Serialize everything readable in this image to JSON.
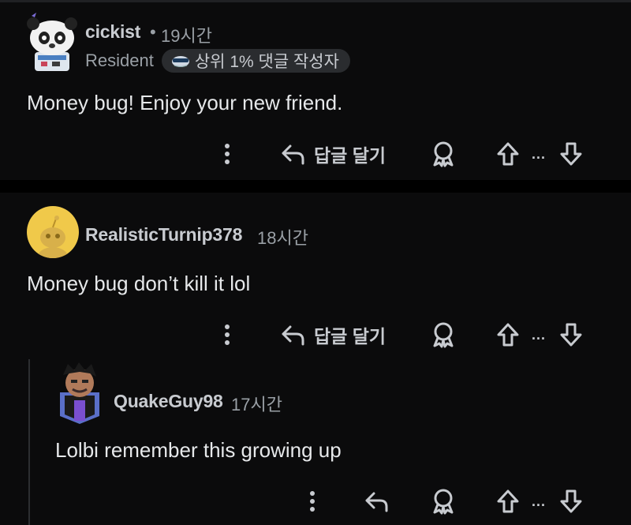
{
  "comments": [
    {
      "username": "cickist",
      "separator": "•",
      "time": "19시간",
      "flair": "Resident",
      "badge_text": "상위 1% 댓글 작성자",
      "body": "Money bug! Enjoy your new friend.",
      "reply_label": "답글 달기",
      "vote_text": "..."
    },
    {
      "username": "RealisticTurnip378",
      "time": "18시간",
      "body": "Money bug don’t kill it lol",
      "reply_label": "답글 달기",
      "vote_text": "..."
    },
    {
      "username": "QuakeGuy98",
      "time": "17시간",
      "body": "Lolbi remember this growing up",
      "vote_text": "..."
    }
  ],
  "icons": {
    "more": "more-vertical-icon",
    "reply": "reply-arrow-icon",
    "award": "award-icon",
    "upvote": "upvote-arrow-icon",
    "downvote": "downvote-arrow-icon"
  },
  "colors": {
    "background": "#0b0b0c",
    "text": "#e6e8ea",
    "muted": "#9aa0a6",
    "badge_bg": "#2a2c2f",
    "avatar2_bg": "#f0c94a"
  }
}
